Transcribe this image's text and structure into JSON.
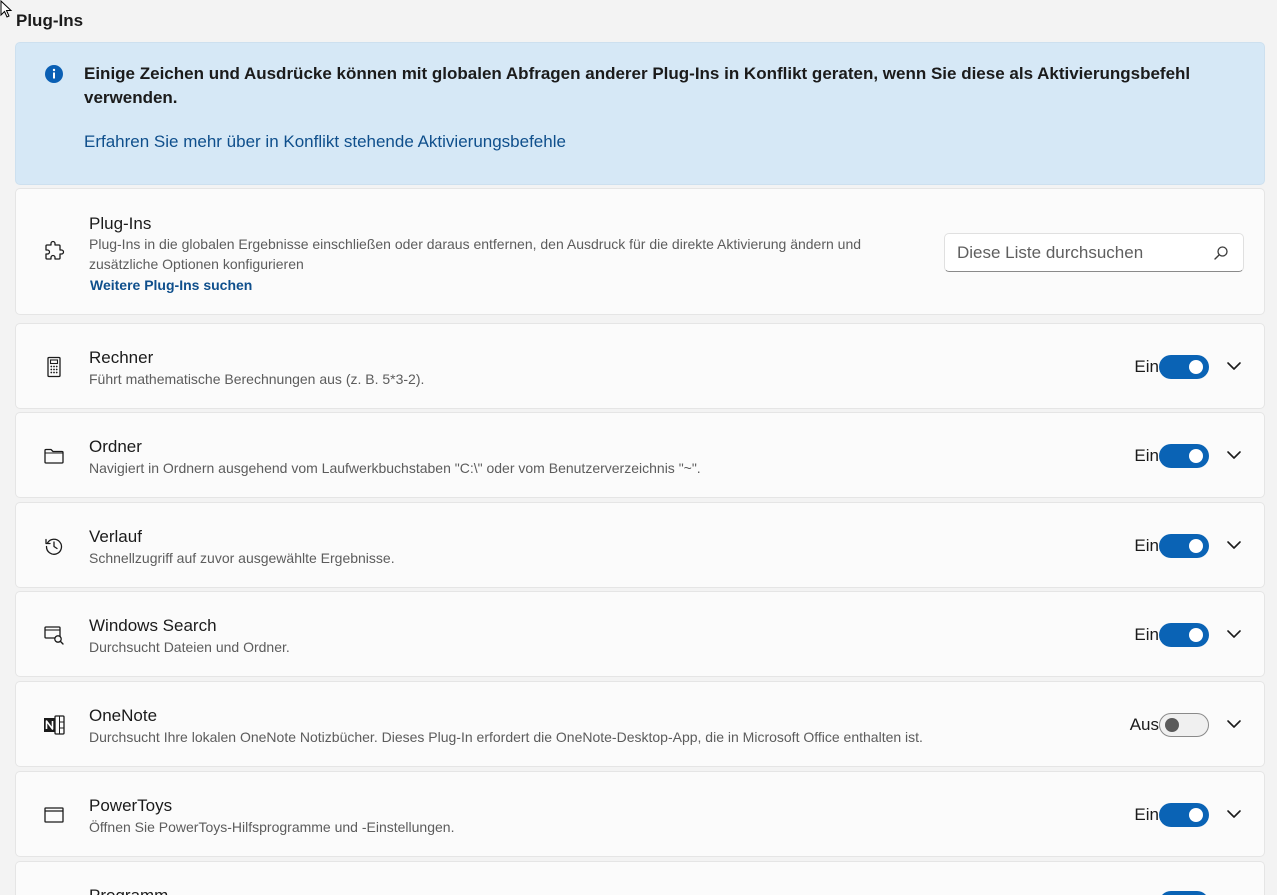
{
  "section": {
    "title": "Plug-Ins"
  },
  "info": {
    "message": "Einige Zeichen und Ausdrücke können mit globalen Abfragen anderer Plug-Ins in Konflikt geraten, wenn Sie diese als Aktivierungsbefehl verwenden.",
    "link": "Erfahren Sie mehr über in Konflikt stehende Aktivierungsbefehle",
    "icon": "info-icon"
  },
  "header": {
    "icon": "puzzle-icon",
    "title": "Plug-Ins",
    "description": "Plug-Ins in die globalen Ergebnisse einschließen oder daraus entfernen, den Ausdruck für die direkte Aktivierung ändern und zusätzliche Optionen konfigurieren",
    "link": "Weitere Plug-Ins suchen",
    "search_placeholder": "Diese Liste durchsuchen"
  },
  "plugins": [
    {
      "icon": "calculator-icon",
      "title": "Rechner",
      "description": "Führt mathematische Berechnungen aus (z. B. 5*3-2).",
      "state": "Ein",
      "enabled": true
    },
    {
      "icon": "folder-icon",
      "title": "Ordner",
      "description": "Navigiert in Ordnern ausgehend vom Laufwerkbuchstaben \"C:\\\" oder vom Benutzerverzeichnis \"~\".",
      "state": "Ein",
      "enabled": true
    },
    {
      "icon": "history-icon",
      "title": "Verlauf",
      "description": "Schnellzugriff auf zuvor ausgewählte Ergebnisse.",
      "state": "Ein",
      "enabled": true
    },
    {
      "icon": "windows-search-icon",
      "title": "Windows Search",
      "description": "Durchsucht Dateien und Ordner.",
      "state": "Ein",
      "enabled": true
    },
    {
      "icon": "onenote-icon",
      "title": "OneNote",
      "description": "Durchsucht Ihre lokalen OneNote Notizbücher. Dieses Plug-In erfordert die OneNote-Desktop-App, die in Microsoft Office enthalten ist.",
      "state": "Aus",
      "enabled": false
    },
    {
      "icon": "window-icon",
      "title": "PowerToys",
      "description": "Öffnen Sie PowerToys-Hilfsprogramme und -Einstellungen.",
      "state": "Ein",
      "enabled": true
    },
    {
      "icon": "program-icon",
      "title": "Programm",
      "description": "",
      "state": "",
      "enabled": true
    }
  ],
  "colors": {
    "accent": "#0a63b5",
    "info_background": "#d6e8f6",
    "link": "#0f4f8c"
  }
}
